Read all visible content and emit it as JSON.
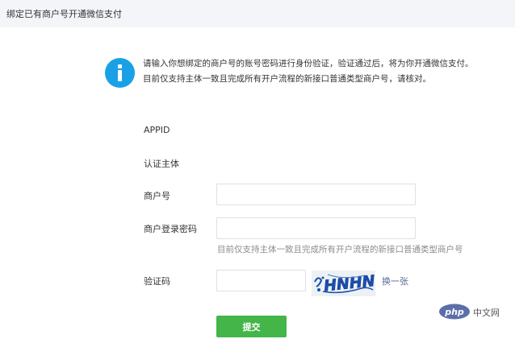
{
  "header": {
    "title": "绑定已有商户号开通微信支付"
  },
  "notice": {
    "icon": "info-icon",
    "lines": [
      "请输入你想绑定的商户号的账号密码进行身份验证，验证通过后，将为你开通微信支付。",
      "目前仅支持主体一致且完成所有开户流程的新接口普通类型商户号，请核对。"
    ]
  },
  "form": {
    "appid_label": "APPID",
    "subject_label": "认证主体",
    "merchant_id_label": "商户号",
    "merchant_id_value": "",
    "password_label": "商户登录密码",
    "password_value": "",
    "password_hint": "目前仅支持主体一致且完成所有开户流程的新接口普通类型商户号",
    "captcha_label": "验证码",
    "captcha_value": "",
    "captcha_image_text": "HNHN",
    "captcha_refresh": "换一张",
    "submit": "提交"
  },
  "watermark": {
    "logo_text": "php",
    "text": "中文网"
  },
  "colors": {
    "accent_blue": "#1aa1e5",
    "primary_green": "#44b549",
    "link": "#576b95",
    "header_bg": "#f4f5f9"
  }
}
